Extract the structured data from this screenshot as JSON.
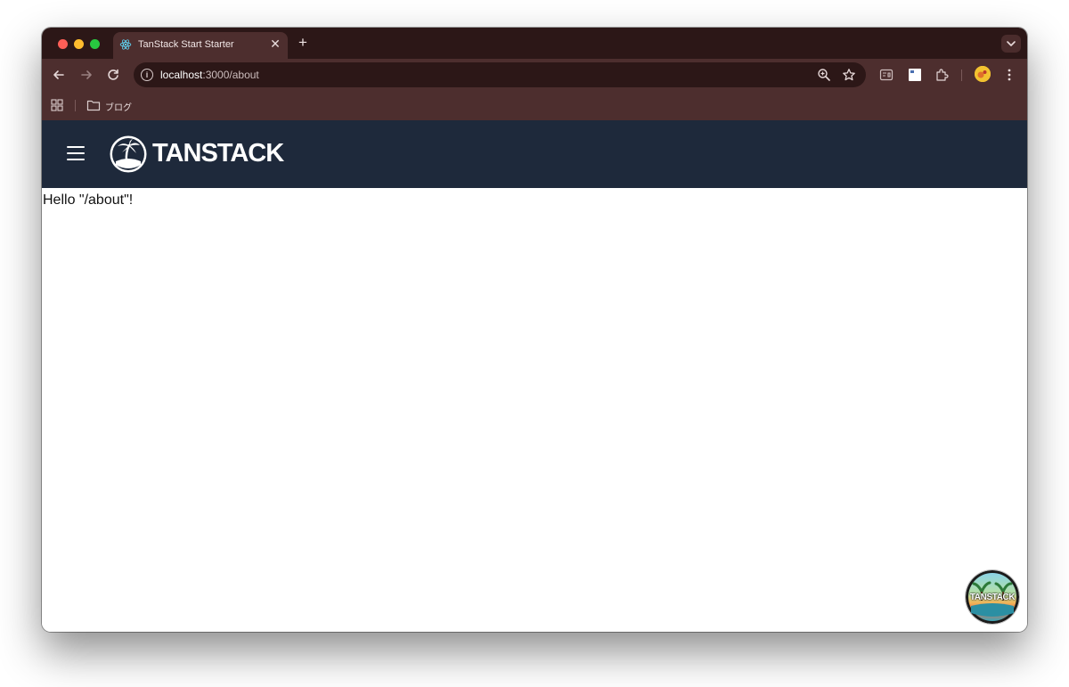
{
  "browser": {
    "tab": {
      "title": "TanStack Start Starter",
      "close_glyph": "✕",
      "favicon": "react-icon"
    },
    "new_tab_glyph": "+",
    "toolbar": {
      "back_glyph": "←",
      "forward_glyph": "→",
      "reload_glyph": "↻",
      "url_host": "localhost",
      "url_path": ":3000/about"
    },
    "bookmarks": {
      "folder_label": "ブログ"
    }
  },
  "page": {
    "header": {
      "logo_text": "TANSTACK",
      "background": "#1e293b"
    },
    "content": {
      "message": "Hello \"/about\"!"
    },
    "devtools_badge": {
      "label": "TANSTACK"
    }
  },
  "colors": {
    "tab_strip": "#2c1717",
    "toolbar": "#4d2e2e",
    "header": "#1e293b"
  }
}
